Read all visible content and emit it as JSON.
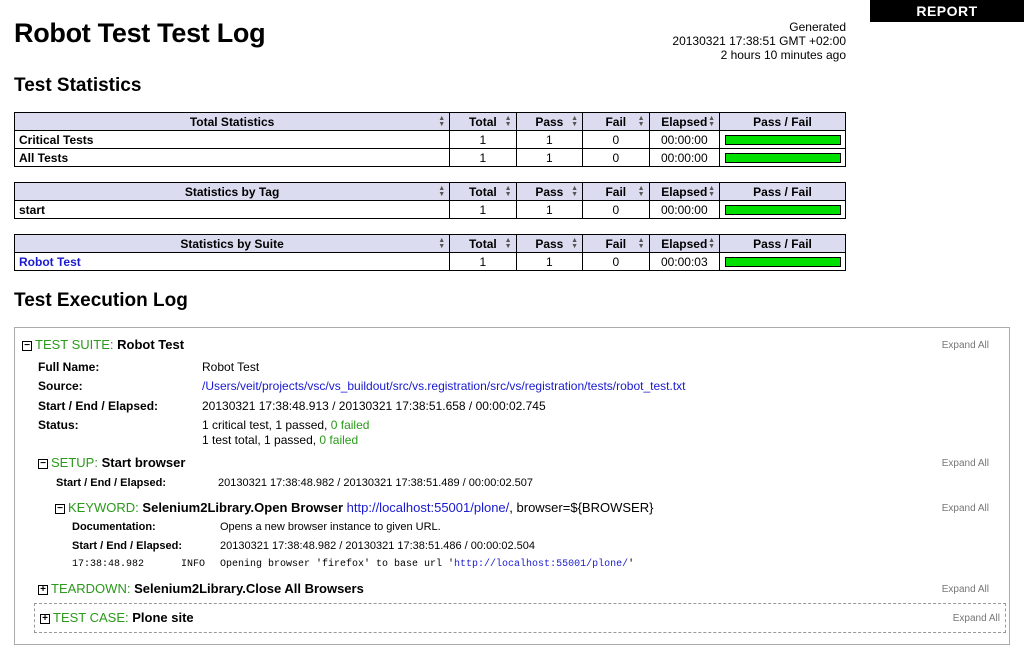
{
  "report_link": "REPORT",
  "title": "Robot Test Test Log",
  "generated": {
    "label": "Generated",
    "timestamp": "20130321 17:38:51 GMT +02:00",
    "ago": "2 hours 10 minutes ago"
  },
  "stats_heading": "Test Statistics",
  "columns": {
    "total": "Total",
    "pass": "Pass",
    "fail": "Fail",
    "elapsed": "Elapsed",
    "passfail": "Pass / Fail"
  },
  "total_stats": {
    "header": "Total Statistics",
    "rows": [
      {
        "name": "Critical Tests",
        "total": "1",
        "pass": "1",
        "fail": "0",
        "elapsed": "00:00:00",
        "pass_ratio": 1.0
      },
      {
        "name": "All Tests",
        "total": "1",
        "pass": "1",
        "fail": "0",
        "elapsed": "00:00:00",
        "pass_ratio": 1.0
      }
    ]
  },
  "tag_stats": {
    "header": "Statistics by Tag",
    "rows": [
      {
        "name": "start",
        "total": "1",
        "pass": "1",
        "fail": "0",
        "elapsed": "00:00:00",
        "pass_ratio": 1.0
      }
    ]
  },
  "suite_stats": {
    "header": "Statistics by Suite",
    "rows": [
      {
        "name": "Robot Test",
        "total": "1",
        "pass": "1",
        "fail": "0",
        "elapsed": "00:00:03",
        "pass_ratio": 1.0
      }
    ]
  },
  "exec_heading": "Test Execution Log",
  "expand_all": "Expand All",
  "suite": {
    "kind": "TEST SUITE:",
    "name": "Robot Test",
    "full_name_label": "Full Name:",
    "full_name": "Robot Test",
    "source_label": "Source:",
    "source": "/Users/veit/projects/vsc/vs_buildout/src/vs.registration/src/vs/registration/tests/robot_test.txt",
    "times_label": "Start / End / Elapsed:",
    "times": "20130321 17:38:48.913 / 20130321 17:38:51.658 / 00:00:02.745",
    "status_label": "Status:",
    "status_line1": "1 critical test, 1 passed,",
    "status_line1_failed": "0 failed",
    "status_line2": "1 test total, 1 passed,",
    "status_line2_failed": "0 failed"
  },
  "setup": {
    "kind": "SETUP:",
    "name": "Start browser",
    "times_label": "Start / End / Elapsed:",
    "times": "20130321 17:38:48.982 / 20130321 17:38:51.489 / 00:00:02.507"
  },
  "keyword": {
    "kind": "KEYWORD:",
    "name": "Selenium2Library.Open Browser",
    "arg_url": "http://localhost:55001/plone/",
    "arg_rest": ", browser=${BROWSER}",
    "doc_label": "Documentation:",
    "doc": "Opens a new browser instance to given URL.",
    "times_label": "Start / End / Elapsed:",
    "times": "20130321 17:38:48.982 / 20130321 17:38:51.486 / 00:00:02.504",
    "msg_time": "17:38:48.982",
    "msg_level": "INFO",
    "msg_text": "Opening browser 'firefox' to base url '",
    "msg_url": "http://localhost:55001/plone/",
    "msg_end": "'"
  },
  "teardown": {
    "kind": "TEARDOWN:",
    "name": "Selenium2Library.Close All Browsers"
  },
  "testcase": {
    "kind": "TEST CASE:",
    "name": "Plone site"
  }
}
